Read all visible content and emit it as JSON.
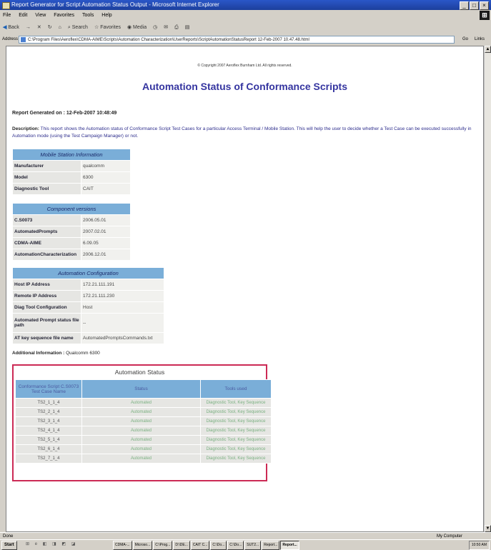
{
  "window": {
    "title": "Report Generator for Script Automation Status Output - Microsoft Internet Explorer",
    "controls": [
      "_",
      "□",
      "×"
    ]
  },
  "menu": [
    "File",
    "Edit",
    "View",
    "Favorites",
    "Tools",
    "Help"
  ],
  "toolbar": {
    "back": "Back",
    "forward": "→",
    "stop": "✕",
    "refresh": "↻",
    "home": "⌂",
    "search": "Search",
    "favorites": "Favorites",
    "media": "Media",
    "history": "◷",
    "mail": "✉",
    "print": "⎙",
    "edit": "▤"
  },
  "address": {
    "label": "Address",
    "url": "C:\\Program Files\\Aeroflex\\CDMA-AIME\\Scripts\\Automation Characterization\\UserReports\\ScriptAutomationStatusReport 12-Feb-2007 10.47.48.html",
    "go": "Go",
    "links": "Links"
  },
  "report": {
    "copyright": "© Copyright 2007 Aeroflex Burnham Ltd. All rights reserved.",
    "title": "Automation Status of Conformance Scripts",
    "generated": "Report Generated on : 12-Feb-2007 10:48:49",
    "description_label": "Description:",
    "description": "This report shows the Automation status of Conformance Script Test Cases for a particular Access Terminal / Mobile Station. This will help the user to decide whether a Test Case can be executed successfully in Automation mode (using the Test Campaign Manager) or not.",
    "mobile_station": {
      "heading": "Mobile Station Information",
      "rows": [
        {
          "key": "Manufacturer",
          "value": "qualcomm"
        },
        {
          "key": "Model",
          "value": "6300"
        },
        {
          "key": "Diagnostic Tool",
          "value": "CAIT"
        }
      ]
    },
    "component_versions": {
      "heading": "Component versions",
      "rows": [
        {
          "key": "C.S0073",
          "value": "2006.05.01"
        },
        {
          "key": "AutomatedPrompts",
          "value": "2007.02.01"
        },
        {
          "key": "CDMA-AIME",
          "value": "6.09.05"
        },
        {
          "key": "AutomationCharacterization",
          "value": "2006.12.01"
        }
      ]
    },
    "automation_configuration": {
      "heading": "Automation Configuration",
      "rows": [
        {
          "key": "Host IP Address",
          "value": "172.21.111.191"
        },
        {
          "key": "Remote IP Address",
          "value": "172.21.111.230"
        },
        {
          "key": "Diag Tool Configuration",
          "value": "Host"
        },
        {
          "key": "Automated Prompt status file path",
          "value": "--"
        },
        {
          "key": "AT key sequence file name",
          "value": "AutomatedPromptsCommands.txt"
        }
      ]
    },
    "additional_label": "Additional Information :",
    "additional_value": "Qualcomm 6300",
    "automation_status": {
      "title": "Automation Status",
      "headers": [
        "Conformance Script C.S0073 Test Case Name",
        "Status",
        "Tools used"
      ],
      "rows": [
        [
          "TS2_1_1_4",
          "Automated",
          "Diagnostic Tool, Key Sequence"
        ],
        [
          "TS2_2_1_4",
          "Automated",
          "Diagnostic Tool, Key Sequence"
        ],
        [
          "TS2_3_1_4",
          "Automated",
          "Diagnostic Tool, Key Sequence"
        ],
        [
          "TS2_4_1_4",
          "Automated",
          "Diagnostic Tool, Key Sequence"
        ],
        [
          "TS2_5_1_4",
          "Automated",
          "Diagnostic Tool, Key Sequence"
        ],
        [
          "TS2_6_1_4",
          "Automated",
          "Diagnostic Tool, Key Sequence"
        ],
        [
          "TS2_7_1_4",
          "Automated",
          "Diagnostic Tool, Key Sequence"
        ]
      ]
    }
  },
  "statusbar": {
    "done": "Done",
    "zone": "My Computer"
  },
  "taskbar": {
    "start": "Start",
    "quicklaunch": "⊞ e ◧ ◨ ◩ ◪",
    "tasks": [
      "CDMA-...",
      "Microso...",
      "C:\\Prog...",
      "D:\\DE...",
      "CAIT C...",
      "C:\\Do...",
      "C:\\Do...",
      "SUT2...",
      "Report...",
      "Report..."
    ],
    "clock": "10:50 AM"
  },
  "colors": {
    "title_blue": "#3535a0",
    "header_blue": "#7aaed8",
    "highlight_border": "#cc2a55"
  }
}
